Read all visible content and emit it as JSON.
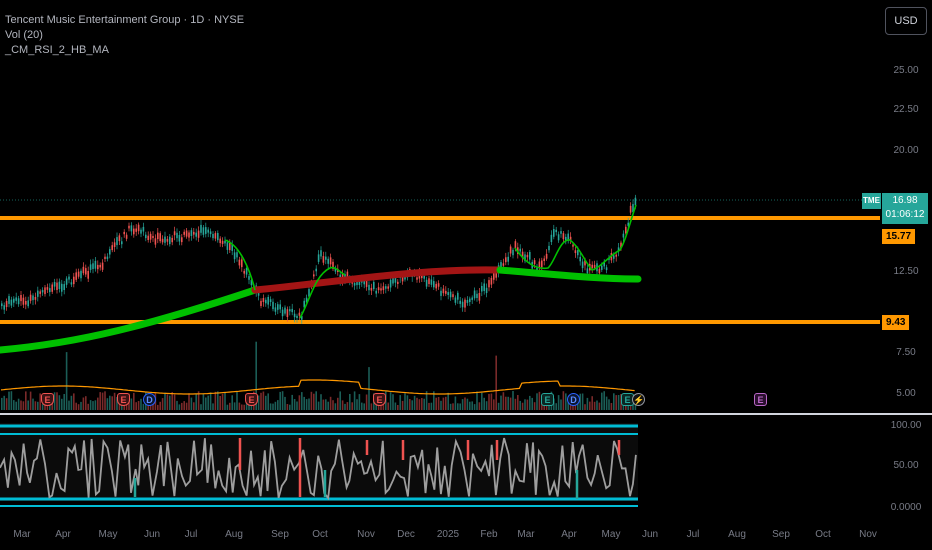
{
  "legend": {
    "title": "Tencent Music Entertainment Group · 1D · NYSE",
    "vol": "Vol (20)",
    "indicator": "_CM_RSI_2_HB_MA"
  },
  "currency": "USD",
  "y_axis": [
    "25.00",
    "22.50",
    "20.00",
    "12.50",
    "7.50",
    "5.00"
  ],
  "price_levels": {
    "upper": "15.77",
    "lower": "9.43"
  },
  "last_price": {
    "symbol": "TME",
    "price": "16.98",
    "countdown": "01:06:12"
  },
  "rsi_axis": [
    "100.00",
    "50.00",
    "0.0000"
  ],
  "x_axis": [
    "Mar",
    "Apr",
    "May",
    "Jun",
    "Jul",
    "Aug",
    "Sep",
    "Oct",
    "Nov",
    "Dec",
    "2025",
    "Feb",
    "Mar",
    "Apr",
    "May",
    "Jun",
    "Jul",
    "Aug",
    "Sep",
    "Oct",
    "Nov"
  ],
  "events": [
    {
      "type": "E",
      "kind": "earnings-missed",
      "label": "E"
    },
    {
      "type": "E",
      "kind": "earnings-missed",
      "label": "E"
    },
    {
      "type": "D",
      "kind": "dividend",
      "label": "D"
    },
    {
      "type": "E",
      "kind": "earnings-missed",
      "label": "E"
    },
    {
      "type": "E",
      "kind": "earnings-missed",
      "label": "E"
    },
    {
      "type": "E",
      "kind": "earnings-beat",
      "label": "E"
    },
    {
      "type": "D",
      "kind": "dividend",
      "label": "D"
    },
    {
      "type": "E",
      "kind": "earnings-beat",
      "label": "E"
    },
    {
      "type": "S",
      "kind": "split",
      "label": "⚡"
    },
    {
      "type": "E",
      "kind": "earnings-upcoming",
      "label": "E"
    }
  ],
  "colors": {
    "up": "#26a69a",
    "down": "#ef5350",
    "level": "#ff9800",
    "ma_up": "#00c000",
    "ma_down": "#b71c1c",
    "rsi": "#9e9e9e",
    "rsi_band": "#00bcd4"
  }
}
